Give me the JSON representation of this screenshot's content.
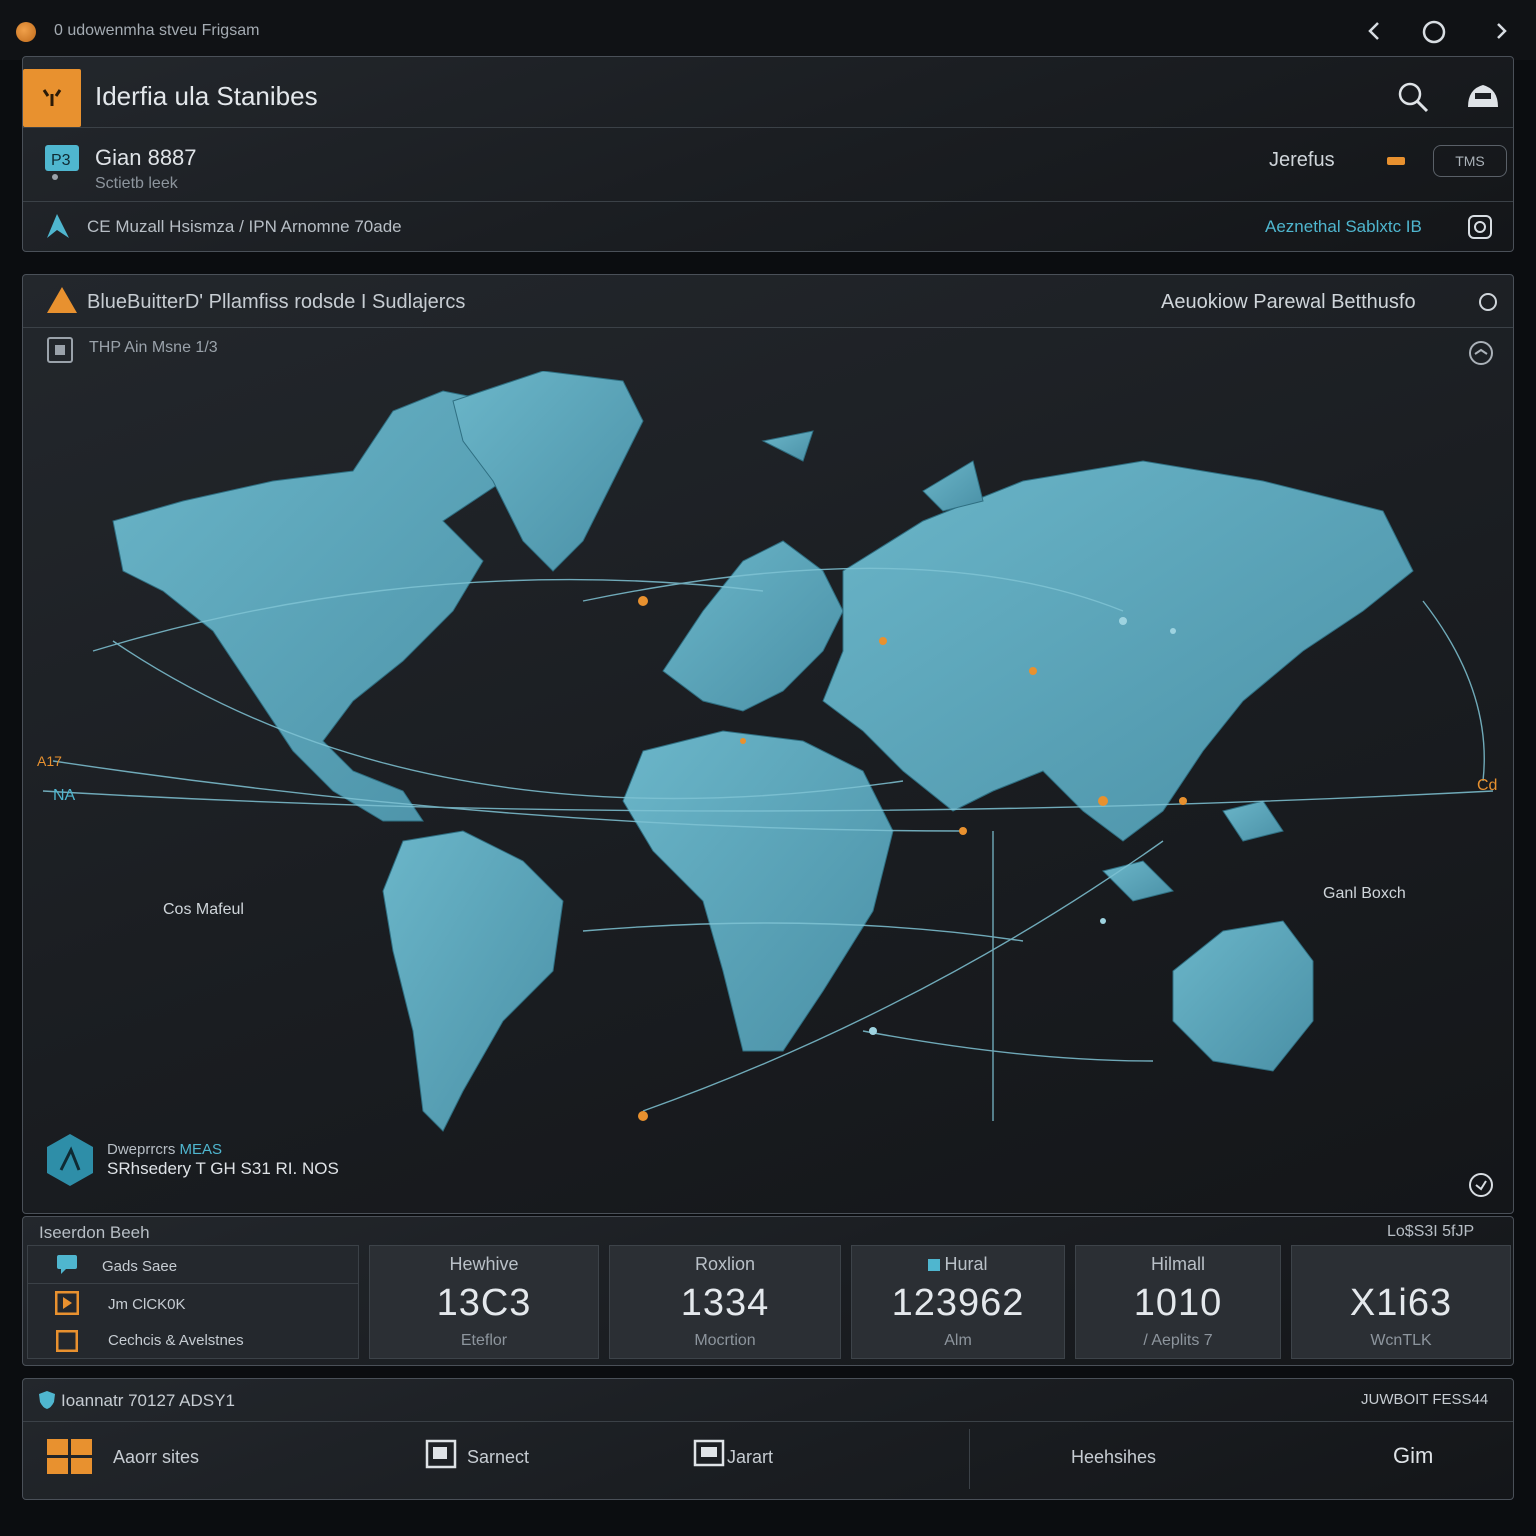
{
  "window": {
    "title": "0 udowenmha stveu Frigsam"
  },
  "header": {
    "app_title": "Iderfia ula Stanibes",
    "project_name": "Gian 8887",
    "project_sub": "Sctietb leek",
    "user_label": "Jerefus",
    "dropdown_value": "TMS",
    "breadcrumb": "CE Muzall Hsismza / IPN Arnomne 70ade",
    "right_link": "Aeznethal Sablxtc IB"
  },
  "map_panel": {
    "title": "BlueBuitterD' Pllamfiss rodsde I Sudlajercs",
    "right_title": "Aeuokiow Parewal Betthusfo",
    "layer_label": "THP Ain Msne  1/3",
    "label_left_top": "A17",
    "label_left_bottom": "NA",
    "label_ocean": "Cos Mafeul",
    "label_right": "Ganl Boxch",
    "label_right_top": "Cd",
    "legend_title": "Dweprrcrs",
    "legend_accent": "MEAS",
    "legend_sub": "SRhsedery T GH S31 RI. NOS"
  },
  "stats": {
    "left_title": "Iseerdon  Beeh",
    "right_title": "Lo$S3I 5fJP",
    "list": [
      {
        "icon": "chat-icon",
        "label": "Gads Saee"
      },
      {
        "icon": "play-icon",
        "label": "Jm ClCK0K"
      },
      {
        "icon": "square-icon",
        "label": "Cechcis & Avelstnes"
      }
    ],
    "tiles": [
      {
        "label": "Hewhive",
        "value": "13C3",
        "sub": "Eteflor"
      },
      {
        "label": "Roxlion",
        "value": "1334",
        "sub": "Mocrtion"
      },
      {
        "label": "Hural",
        "value": "123962",
        "sub": "Alm"
      },
      {
        "label": "Hilmall",
        "value": "1010",
        "sub": "/ Aeplits 7"
      },
      {
        "label": "",
        "value": "X1i63",
        "sub": "WcnTLK"
      }
    ]
  },
  "footer": {
    "title": "Ioannatr 70127 ADSY1",
    "right_title": "JUWBOIT FESS44",
    "actions": [
      {
        "label": "Aaorr sites"
      },
      {
        "label": "Sarnect"
      },
      {
        "label": "Jarart"
      },
      {
        "label": "Heehsihes"
      },
      {
        "label": "Gim"
      }
    ]
  },
  "colors": {
    "accent_orange": "#e8912f",
    "land": "#5aa3b8",
    "route": "#7fc3d4",
    "panel_bg": "#1c1f23"
  }
}
